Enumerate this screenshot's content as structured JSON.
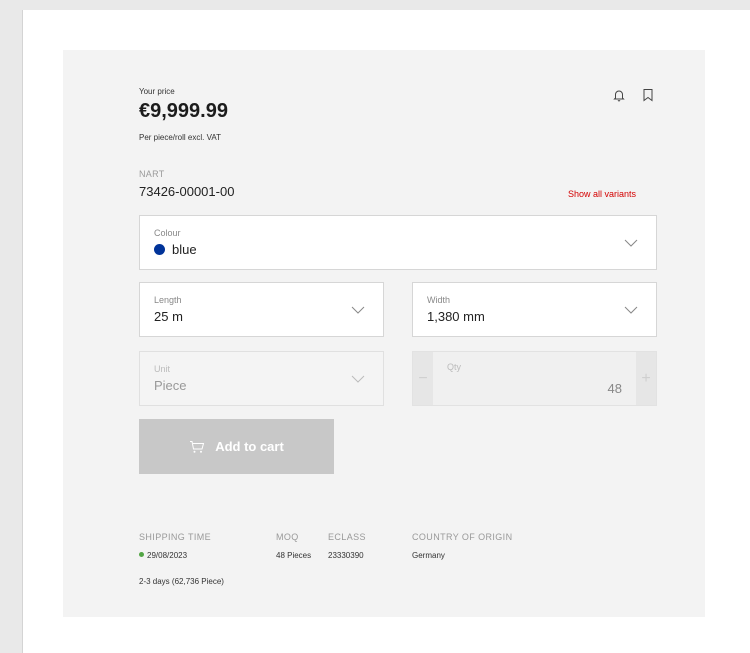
{
  "product": {
    "price_label": "Your price",
    "price": "€9,999.99",
    "price_note": "Per piece/roll excl. VAT",
    "nart_label": "NART",
    "nart_value": "73426-00001-00",
    "show_variants": "Show all variants"
  },
  "fields": {
    "colour": {
      "label": "Colour",
      "value": "blue",
      "swatch_color": "#003399"
    },
    "length": {
      "label": "Length",
      "value": "25 m"
    },
    "width": {
      "label": "Width",
      "value": "1,380 mm"
    },
    "unit": {
      "label": "Unit",
      "value": "Piece"
    },
    "qty": {
      "label": "Qty",
      "value": "48",
      "minus": "−",
      "plus": "+"
    }
  },
  "cart": {
    "label": "Add to cart"
  },
  "meta": {
    "shipping_time_label": "SHIPPING TIME",
    "shipping_date": "29/08/2023",
    "shipping_days": "2-3 days (62,736 Piece)",
    "moq_label": "MOQ",
    "moq_value": "48 Pieces",
    "eclass_label": "ECLASS",
    "eclass_value": "23330390",
    "origin_label": "COUNTRY OF ORIGIN",
    "origin_value": "Germany"
  },
  "icons": [
    "bell-icon",
    "bookmark-icon",
    "chevron-down-icon",
    "cart-icon"
  ],
  "colors": {
    "accent_red": "#d40000",
    "status_green": "#52a544",
    "disabled_button": "#c8c8c8"
  }
}
